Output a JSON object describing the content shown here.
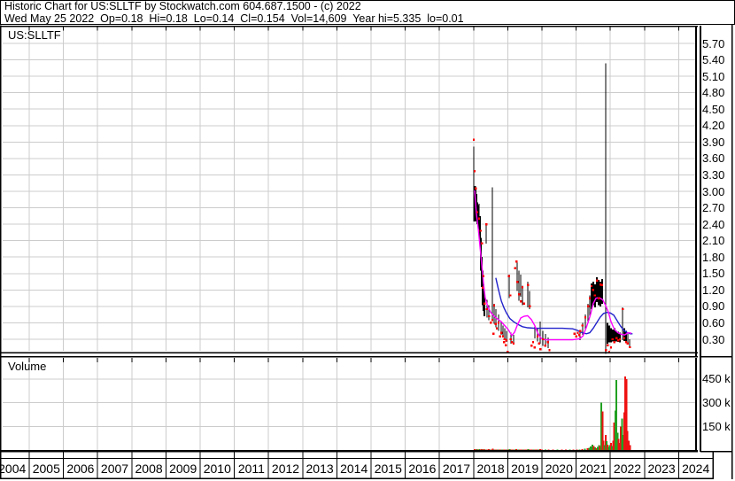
{
  "header": {
    "line1": "Historic Chart for US:SLLTF by Stockwatch.com 604.687.1500 - (c) 2022",
    "line2": "Wed May 25 2022  Op=0.18  Hi=0.18  Lo=0.14  Cl=0.154  Vol=14,609  Year hi=5.335  lo=0.01"
  },
  "price_pane": {
    "symbol_label": "US:SLLTF"
  },
  "volume_pane": {
    "label": "Volume"
  },
  "chart_data": {
    "type": "candlestick",
    "title": "Historic Chart for US:SLLTF",
    "symbol": "US:SLLTF",
    "grid": true,
    "x_axis": {
      "years": [
        "2004",
        "2005",
        "2006",
        "2007",
        "2008",
        "2009",
        "2010",
        "2011",
        "2012",
        "2013",
        "2014",
        "2015",
        "2016",
        "2017",
        "2018",
        "2019",
        "2020",
        "2021",
        "2022",
        "2023",
        "2024"
      ]
    },
    "price_axis": {
      "side": "right",
      "min": 0.3,
      "max": 5.7,
      "step": 0.3,
      "ticks": [
        "5.70",
        "5.40",
        "5.10",
        "4.80",
        "4.50",
        "4.20",
        "3.90",
        "3.60",
        "3.30",
        "3.00",
        "2.70",
        "2.40",
        "2.10",
        "1.80",
        "1.50",
        "1.20",
        "0.90",
        "0.60",
        "0.30"
      ]
    },
    "volume_axis": {
      "unit": "k",
      "ticks": [
        {
          "label": "450 k",
          "value": 450
        },
        {
          "label": "300 k",
          "value": 300
        },
        {
          "label": "150 k",
          "value": 150
        }
      ]
    },
    "colors": {
      "bar": "#000000",
      "close_dot": "#ff0000",
      "ma_fast": "#ff00ff",
      "ma_slow": "#2222cc",
      "volume_up": "#22a022",
      "volume_down": "#ee1111",
      "grid": "#cccccc",
      "frame": "#000000"
    },
    "price_bars": [
      [
        2018.005,
        3.82,
        2.77,
        1
      ],
      [
        2018.031,
        3.1,
        2.45,
        3
      ],
      [
        2018.057,
        3.05,
        2.5,
        2
      ],
      [
        2018.083,
        2.95,
        2.45,
        2
      ],
      [
        2018.109,
        2.8,
        2.4,
        2
      ],
      [
        2018.135,
        2.75,
        2.35,
        2
      ],
      [
        2018.16,
        2.77,
        2.3,
        1
      ],
      [
        2018.186,
        2.55,
        2.05,
        2
      ],
      [
        2018.212,
        2.15,
        1.55,
        2
      ],
      [
        2018.238,
        1.8,
        1.25,
        2
      ],
      [
        2018.264,
        1.55,
        0.92,
        2
      ],
      [
        2018.29,
        1.3,
        0.82,
        2
      ],
      [
        2018.316,
        1.15,
        0.72,
        2
      ],
      [
        2018.368,
        2.42,
        2.05,
        1
      ],
      [
        2018.394,
        1.02,
        0.7,
        1
      ],
      [
        2018.446,
        0.92,
        0.65,
        1
      ],
      [
        2018.549,
        3.07,
        0.67,
        1
      ],
      [
        2018.601,
        0.95,
        0.58,
        1
      ],
      [
        2018.653,
        0.85,
        0.52,
        1
      ],
      [
        2018.731,
        0.75,
        0.45,
        1
      ],
      [
        2018.808,
        0.62,
        0.38,
        1
      ],
      [
        2018.86,
        0.55,
        0.33,
        1
      ],
      [
        2018.912,
        0.5,
        0.28,
        1
      ],
      [
        2018.964,
        0.45,
        0.25,
        1
      ],
      [
        2019.041,
        1.48,
        1.05,
        1
      ],
      [
        2019.093,
        0.42,
        0.22,
        1
      ],
      [
        2019.171,
        0.38,
        0.2,
        1
      ],
      [
        2019.275,
        1.7,
        1.18,
        1
      ],
      [
        2019.326,
        1.55,
        1.0,
        1
      ],
      [
        2019.378,
        1.48,
        1.08,
        1
      ],
      [
        2019.43,
        1.28,
        0.92,
        1
      ],
      [
        2019.585,
        1.35,
        0.88,
        1
      ],
      [
        2019.637,
        1.18,
        0.85,
        1
      ],
      [
        2019.792,
        0.55,
        0.32,
        1
      ],
      [
        2019.87,
        0.5,
        0.26,
        1
      ],
      [
        2019.948,
        0.62,
        0.22,
        1
      ],
      [
        2020.025,
        0.45,
        0.18,
        1
      ],
      [
        2020.103,
        0.4,
        0.16,
        1
      ],
      [
        2020.181,
        0.33,
        0.14,
        1
      ],
      [
        2021.114,
        0.45,
        0.28,
        1
      ],
      [
        2021.192,
        0.6,
        0.38,
        1
      ],
      [
        2021.269,
        0.75,
        0.48,
        1
      ],
      [
        2021.347,
        0.95,
        0.62,
        1
      ],
      [
        2021.399,
        1.1,
        0.72,
        1
      ],
      [
        2021.451,
        1.32,
        0.85,
        2
      ],
      [
        2021.503,
        1.35,
        0.92,
        2
      ],
      [
        2021.554,
        1.3,
        0.88,
        2
      ],
      [
        2021.606,
        1.43,
        0.98,
        2
      ],
      [
        2021.658,
        1.38,
        0.92,
        2
      ],
      [
        2021.71,
        1.35,
        0.9,
        2
      ],
      [
        2021.761,
        1.4,
        0.95,
        2
      ],
      [
        2021.865,
        5.34,
        0.03,
        1
      ],
      [
        2021.917,
        0.6,
        0.22,
        2
      ],
      [
        2021.969,
        0.55,
        0.24,
        2
      ],
      [
        2022.021,
        0.5,
        0.24,
        2
      ],
      [
        2022.072,
        0.48,
        0.26,
        2
      ],
      [
        2022.124,
        0.5,
        0.27,
        2
      ],
      [
        2022.176,
        0.45,
        0.26,
        2
      ],
      [
        2022.228,
        0.44,
        0.25,
        2
      ],
      [
        2022.28,
        0.42,
        0.24,
        2
      ],
      [
        2022.358,
        0.88,
        0.28,
        1
      ],
      [
        2022.409,
        0.5,
        0.27,
        2
      ],
      [
        2022.461,
        0.45,
        0.24,
        2
      ],
      [
        2022.513,
        0.4,
        0.2,
        1
      ],
      [
        2022.565,
        0.3,
        0.14,
        1
      ]
    ],
    "close_marks": [
      [
        2018.005,
        3.94
      ],
      [
        2018.031,
        3.37
      ],
      [
        2018.06,
        3.05
      ],
      [
        2018.11,
        2.62
      ],
      [
        2018.16,
        2.5
      ],
      [
        2018.21,
        2.28
      ],
      [
        2018.24,
        2.05
      ],
      [
        2018.264,
        1.24
      ],
      [
        2018.29,
        1.45
      ],
      [
        2018.32,
        0.95
      ],
      [
        2018.37,
        2.4
      ],
      [
        2018.39,
        0.85
      ],
      [
        2018.45,
        0.72
      ],
      [
        2018.5,
        0.6
      ],
      [
        2018.55,
        0.65
      ],
      [
        2018.58,
        0.4
      ],
      [
        2018.6,
        0.92
      ],
      [
        2018.65,
        0.58
      ],
      [
        2018.68,
        0.5
      ],
      [
        2018.73,
        0.6
      ],
      [
        2018.78,
        0.35
      ],
      [
        2018.81,
        0.42
      ],
      [
        2018.86,
        0.35
      ],
      [
        2018.89,
        0.25
      ],
      [
        2018.91,
        0.3
      ],
      [
        2018.94,
        0.19
      ],
      [
        2018.96,
        0.28
      ],
      [
        2019.0,
        0.06
      ],
      [
        2019.04,
        1.45
      ],
      [
        2019.07,
        1.1
      ],
      [
        2019.09,
        0.3
      ],
      [
        2019.12,
        0.25
      ],
      [
        2019.17,
        0.22
      ],
      [
        2019.22,
        1.6
      ],
      [
        2019.25,
        1.72
      ],
      [
        2019.28,
        1.35
      ],
      [
        2019.33,
        1.12
      ],
      [
        2019.38,
        0.99
      ],
      [
        2019.43,
        1.25
      ],
      [
        2019.48,
        0.95
      ],
      [
        2019.59,
        1.29
      ],
      [
        2019.64,
        0.9
      ],
      [
        2019.7,
        0.18
      ],
      [
        2019.74,
        0.25
      ],
      [
        2019.79,
        0.15
      ],
      [
        2019.87,
        0.35
      ],
      [
        2019.92,
        0.22
      ],
      [
        2019.95,
        0.12
      ],
      [
        2020.03,
        0.3
      ],
      [
        2020.1,
        0.18
      ],
      [
        2020.18,
        0.25
      ],
      [
        2020.22,
        0.1
      ],
      [
        2020.95,
        0.4
      ],
      [
        2021.0,
        0.35
      ],
      [
        2021.05,
        0.42
      ],
      [
        2021.09,
        0.38
      ],
      [
        2021.12,
        0.45
      ],
      [
        2021.19,
        0.55
      ],
      [
        2021.27,
        0.7
      ],
      [
        2021.35,
        0.9
      ],
      [
        2021.4,
        1.05
      ],
      [
        2021.45,
        1.27
      ],
      [
        2021.5,
        1.2
      ],
      [
        2021.55,
        1.1
      ],
      [
        2021.61,
        1.37
      ],
      [
        2021.66,
        1.05
      ],
      [
        2021.71,
        1.3
      ],
      [
        2021.76,
        1.29
      ],
      [
        2021.87,
        0.1
      ],
      [
        2021.92,
        0.19
      ],
      [
        2021.97,
        0.05
      ],
      [
        2022.02,
        0.15
      ],
      [
        2022.07,
        0.3
      ],
      [
        2022.12,
        0.25
      ],
      [
        2022.18,
        0.32
      ],
      [
        2022.23,
        0.28
      ],
      [
        2022.28,
        0.3
      ],
      [
        2022.36,
        0.85
      ],
      [
        2022.41,
        0.32
      ],
      [
        2022.46,
        0.25
      ],
      [
        2022.51,
        0.22
      ],
      [
        2022.57,
        0.154
      ]
    ],
    "ma_fast_magenta": [
      [
        2018.03,
        3.02
      ],
      [
        2018.08,
        2.6
      ],
      [
        2018.14,
        2.3
      ],
      [
        2018.19,
        1.98
      ],
      [
        2018.24,
        1.65
      ],
      [
        2018.29,
        1.32
      ],
      [
        2018.34,
        1.06
      ],
      [
        2018.42,
        0.89
      ],
      [
        2018.5,
        0.79
      ],
      [
        2018.6,
        0.72
      ],
      [
        2018.7,
        0.67
      ],
      [
        2018.81,
        0.62
      ],
      [
        2018.91,
        0.55
      ],
      [
        2019.01,
        0.48
      ],
      [
        2019.12,
        0.37
      ],
      [
        2019.2,
        0.43
      ],
      [
        2019.28,
        0.56
      ],
      [
        2019.38,
        0.69
      ],
      [
        2019.48,
        0.72
      ],
      [
        2019.58,
        0.73
      ],
      [
        2019.69,
        0.66
      ],
      [
        2019.79,
        0.55
      ],
      [
        2019.87,
        0.42
      ],
      [
        2019.97,
        0.32
      ],
      [
        2020.08,
        0.29
      ],
      [
        2020.3,
        0.29
      ],
      [
        2020.6,
        0.29
      ],
      [
        2020.9,
        0.29
      ],
      [
        2021.1,
        0.31
      ],
      [
        2021.2,
        0.36
      ],
      [
        2021.3,
        0.52
      ],
      [
        2021.36,
        0.63
      ],
      [
        2021.42,
        0.75
      ],
      [
        2021.5,
        0.95
      ],
      [
        2021.58,
        1.05
      ],
      [
        2021.68,
        1.06
      ],
      [
        2021.78,
        1.02
      ],
      [
        2021.86,
        0.92
      ],
      [
        2021.94,
        0.8
      ],
      [
        2022.02,
        0.62
      ],
      [
        2022.12,
        0.48
      ],
      [
        2022.22,
        0.42
      ],
      [
        2022.32,
        0.39
      ],
      [
        2022.42,
        0.38
      ],
      [
        2022.52,
        0.42
      ],
      [
        2022.62,
        0.41
      ]
    ],
    "ma_slow_blue": [
      [
        2018.65,
        1.42
      ],
      [
        2018.73,
        1.2
      ],
      [
        2018.81,
        1.0
      ],
      [
        2018.89,
        0.87
      ],
      [
        2018.96,
        0.78
      ],
      [
        2019.06,
        0.68
      ],
      [
        2019.17,
        0.62
      ],
      [
        2019.3,
        0.57
      ],
      [
        2019.43,
        0.53
      ],
      [
        2019.58,
        0.51
      ],
      [
        2019.79,
        0.5
      ],
      [
        2020.0,
        0.5
      ],
      [
        2020.3,
        0.5
      ],
      [
        2020.6,
        0.5
      ],
      [
        2020.9,
        0.49
      ],
      [
        2021.05,
        0.46
      ],
      [
        2021.18,
        0.42
      ],
      [
        2021.3,
        0.4
      ],
      [
        2021.4,
        0.42
      ],
      [
        2021.5,
        0.5
      ],
      [
        2021.6,
        0.6
      ],
      [
        2021.7,
        0.7
      ],
      [
        2021.8,
        0.77
      ],
      [
        2021.9,
        0.79
      ],
      [
        2022.0,
        0.78
      ],
      [
        2022.1,
        0.74
      ],
      [
        2022.2,
        0.64
      ],
      [
        2022.3,
        0.54
      ],
      [
        2022.4,
        0.46
      ],
      [
        2022.5,
        0.42
      ],
      [
        2022.58,
        0.4
      ],
      [
        2022.65,
        0.4
      ]
    ],
    "volume_bars": [
      [
        2018.03,
        5,
        "r"
      ],
      [
        2018.06,
        3,
        "r"
      ],
      [
        2018.09,
        6,
        "g"
      ],
      [
        2018.12,
        4,
        "r"
      ],
      [
        2018.15,
        3,
        "r"
      ],
      [
        2018.18,
        5,
        "g"
      ],
      [
        2018.21,
        4,
        "r"
      ],
      [
        2018.24,
        6,
        "r"
      ],
      [
        2018.27,
        3,
        "g"
      ],
      [
        2018.3,
        5,
        "r"
      ],
      [
        2018.33,
        3,
        "r"
      ],
      [
        2018.36,
        4,
        "g"
      ],
      [
        2018.4,
        3,
        "r"
      ],
      [
        2018.44,
        5,
        "r"
      ],
      [
        2018.48,
        3,
        "g"
      ],
      [
        2018.52,
        4,
        "r"
      ],
      [
        2018.56,
        8,
        "r"
      ],
      [
        2018.6,
        4,
        "g"
      ],
      [
        2018.64,
        3,
        "r"
      ],
      [
        2018.68,
        4,
        "r"
      ],
      [
        2018.72,
        3,
        "g"
      ],
      [
        2018.76,
        3,
        "r"
      ],
      [
        2018.8,
        4,
        "r"
      ],
      [
        2018.84,
        3,
        "g"
      ],
      [
        2018.88,
        3,
        "r"
      ],
      [
        2018.92,
        4,
        "r"
      ],
      [
        2018.96,
        3,
        "g"
      ],
      [
        2019.0,
        4,
        "r"
      ],
      [
        2019.05,
        5,
        "g"
      ],
      [
        2019.1,
        3,
        "r"
      ],
      [
        2019.15,
        3,
        "r"
      ],
      [
        2019.2,
        4,
        "g"
      ],
      [
        2019.25,
        5,
        "r"
      ],
      [
        2019.3,
        4,
        "g"
      ],
      [
        2019.35,
        3,
        "r"
      ],
      [
        2019.4,
        3,
        "r"
      ],
      [
        2019.45,
        4,
        "g"
      ],
      [
        2019.5,
        3,
        "r"
      ],
      [
        2019.55,
        4,
        "r"
      ],
      [
        2019.6,
        5,
        "g"
      ],
      [
        2019.65,
        3,
        "r"
      ],
      [
        2019.7,
        3,
        "r"
      ],
      [
        2019.75,
        4,
        "g"
      ],
      [
        2019.8,
        3,
        "r"
      ],
      [
        2019.85,
        3,
        "r"
      ],
      [
        2019.9,
        4,
        "g"
      ],
      [
        2019.95,
        5,
        "r"
      ],
      [
        2020.0,
        3,
        "r"
      ],
      [
        2020.1,
        3,
        "g"
      ],
      [
        2020.2,
        4,
        "r"
      ],
      [
        2020.32,
        2,
        "r"
      ],
      [
        2020.45,
        2,
        "g"
      ],
      [
        2020.58,
        2,
        "r"
      ],
      [
        2020.7,
        2,
        "r"
      ],
      [
        2020.82,
        3,
        "g"
      ],
      [
        2020.92,
        3,
        "r"
      ],
      [
        2021.02,
        3,
        "r"
      ],
      [
        2021.1,
        4,
        "g"
      ],
      [
        2021.18,
        6,
        "r"
      ],
      [
        2021.26,
        8,
        "g"
      ],
      [
        2021.33,
        10,
        "r"
      ],
      [
        2021.38,
        14,
        "g"
      ],
      [
        2021.43,
        22,
        "g"
      ],
      [
        2021.48,
        35,
        "g"
      ],
      [
        2021.51,
        26,
        "r"
      ],
      [
        2021.55,
        16,
        "g"
      ],
      [
        2021.59,
        11,
        "r"
      ],
      [
        2021.63,
        19,
        "g"
      ],
      [
        2021.67,
        30,
        "g"
      ],
      [
        2021.7,
        24,
        "r"
      ],
      [
        2021.74,
        300,
        "g"
      ],
      [
        2021.77,
        245,
        "r"
      ],
      [
        2021.8,
        60,
        "r"
      ],
      [
        2021.83,
        30,
        "g"
      ],
      [
        2021.86,
        95,
        "r"
      ],
      [
        2021.89,
        55,
        "g"
      ],
      [
        2021.92,
        35,
        "r"
      ],
      [
        2021.95,
        20,
        "g"
      ],
      [
        2021.98,
        30,
        "g"
      ],
      [
        2022.02,
        45,
        "r"
      ],
      [
        2022.05,
        25,
        "g"
      ],
      [
        2022.08,
        60,
        "r"
      ],
      [
        2022.11,
        175,
        "r"
      ],
      [
        2022.15,
        250,
        "g"
      ],
      [
        2022.18,
        445,
        "g"
      ],
      [
        2022.21,
        110,
        "g"
      ],
      [
        2022.24,
        70,
        "r"
      ],
      [
        2022.28,
        45,
        "r"
      ],
      [
        2022.31,
        150,
        "r"
      ],
      [
        2022.34,
        200,
        "g"
      ],
      [
        2022.37,
        95,
        "g"
      ],
      [
        2022.41,
        240,
        "r"
      ],
      [
        2022.44,
        465,
        "r"
      ],
      [
        2022.47,
        450,
        "r"
      ],
      [
        2022.5,
        120,
        "r"
      ],
      [
        2022.54,
        60,
        "r"
      ],
      [
        2022.58,
        30,
        "r"
      ]
    ]
  }
}
